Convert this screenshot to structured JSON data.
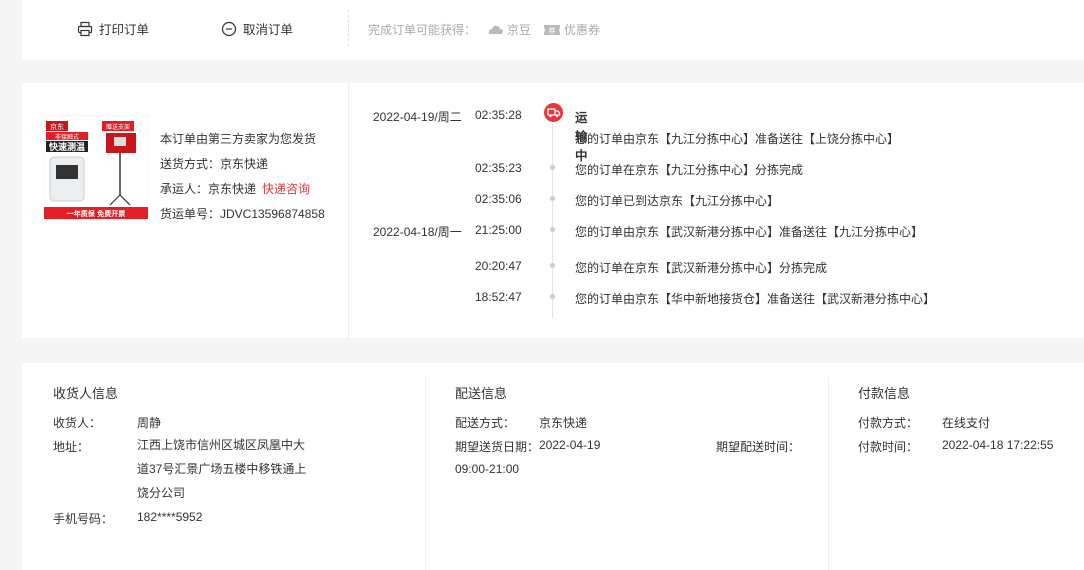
{
  "actions": {
    "print_label": "打印订单",
    "cancel_label": "取消订单"
  },
  "reward": {
    "label": "完成订单可能获得：",
    "jingdou": "京豆",
    "coupon": "优惠券"
  },
  "product": {
    "image_texts": [
      "京东",
      "非接触式",
      "快速测温",
      "赠送支架",
      "一年质保  免费开票"
    ],
    "seller_note": "本订单由第三方卖家为您发货",
    "delivery_method": "送货方式：京东快递",
    "carrier_label": "承运人：京东快递",
    "consult_link": "快递咨询",
    "waybill": "货运单号：JDVC13596874858"
  },
  "tracking": {
    "status": "运输中",
    "events": [
      {
        "date": "2022-04-19/周二",
        "time": "02:35:28",
        "msg": "您的订单由京东【九江分拣中心】准备送往【上饶分拣中心】"
      },
      {
        "date": "",
        "time": "02:35:23",
        "msg": "您的订单在京东【九江分拣中心】分拣完成"
      },
      {
        "date": "",
        "time": "02:35:06",
        "msg": "您的订单已到达京东【九江分拣中心】"
      },
      {
        "date": "2022-04-18/周一",
        "time": "21:25:00",
        "msg": "您的订单由京东【武汉新港分拣中心】准备送往【九江分拣中心】"
      },
      {
        "date": "",
        "time": "20:20:47",
        "msg": "您的订单在京东【武汉新港分拣中心】分拣完成"
      },
      {
        "date": "",
        "time": "18:52:47",
        "msg": "您的订单由京东【华中新地接货仓】准备送往【武汉新港分拣中心】"
      }
    ]
  },
  "receiver": {
    "title": "收货人信息",
    "name_label": "收货人：",
    "name": "周静",
    "address_label": "地址：",
    "address_lines": [
      "江西上饶市信州区城区凤凰中大",
      "道37号汇景广场五楼中移铁通上",
      "饶分公司"
    ],
    "phone_label": "手机号码：",
    "phone": "182****5952"
  },
  "delivery": {
    "title": "配送信息",
    "method_label": "配送方式：",
    "method": "京东快递",
    "date_label": "期望送货日期：",
    "date": "2022-04-19",
    "time_label": "期望配送时间：",
    "time_range": "09:00-21:00"
  },
  "payment": {
    "title": "付款信息",
    "method_label": "付款方式：",
    "method": "在线支付",
    "time_label": "付款时间：",
    "time": "2022-04-18 17:22:55"
  },
  "colors": {
    "accent": "#e4393c",
    "muted": "#aaaaaa",
    "background": "#f5f5f5"
  }
}
